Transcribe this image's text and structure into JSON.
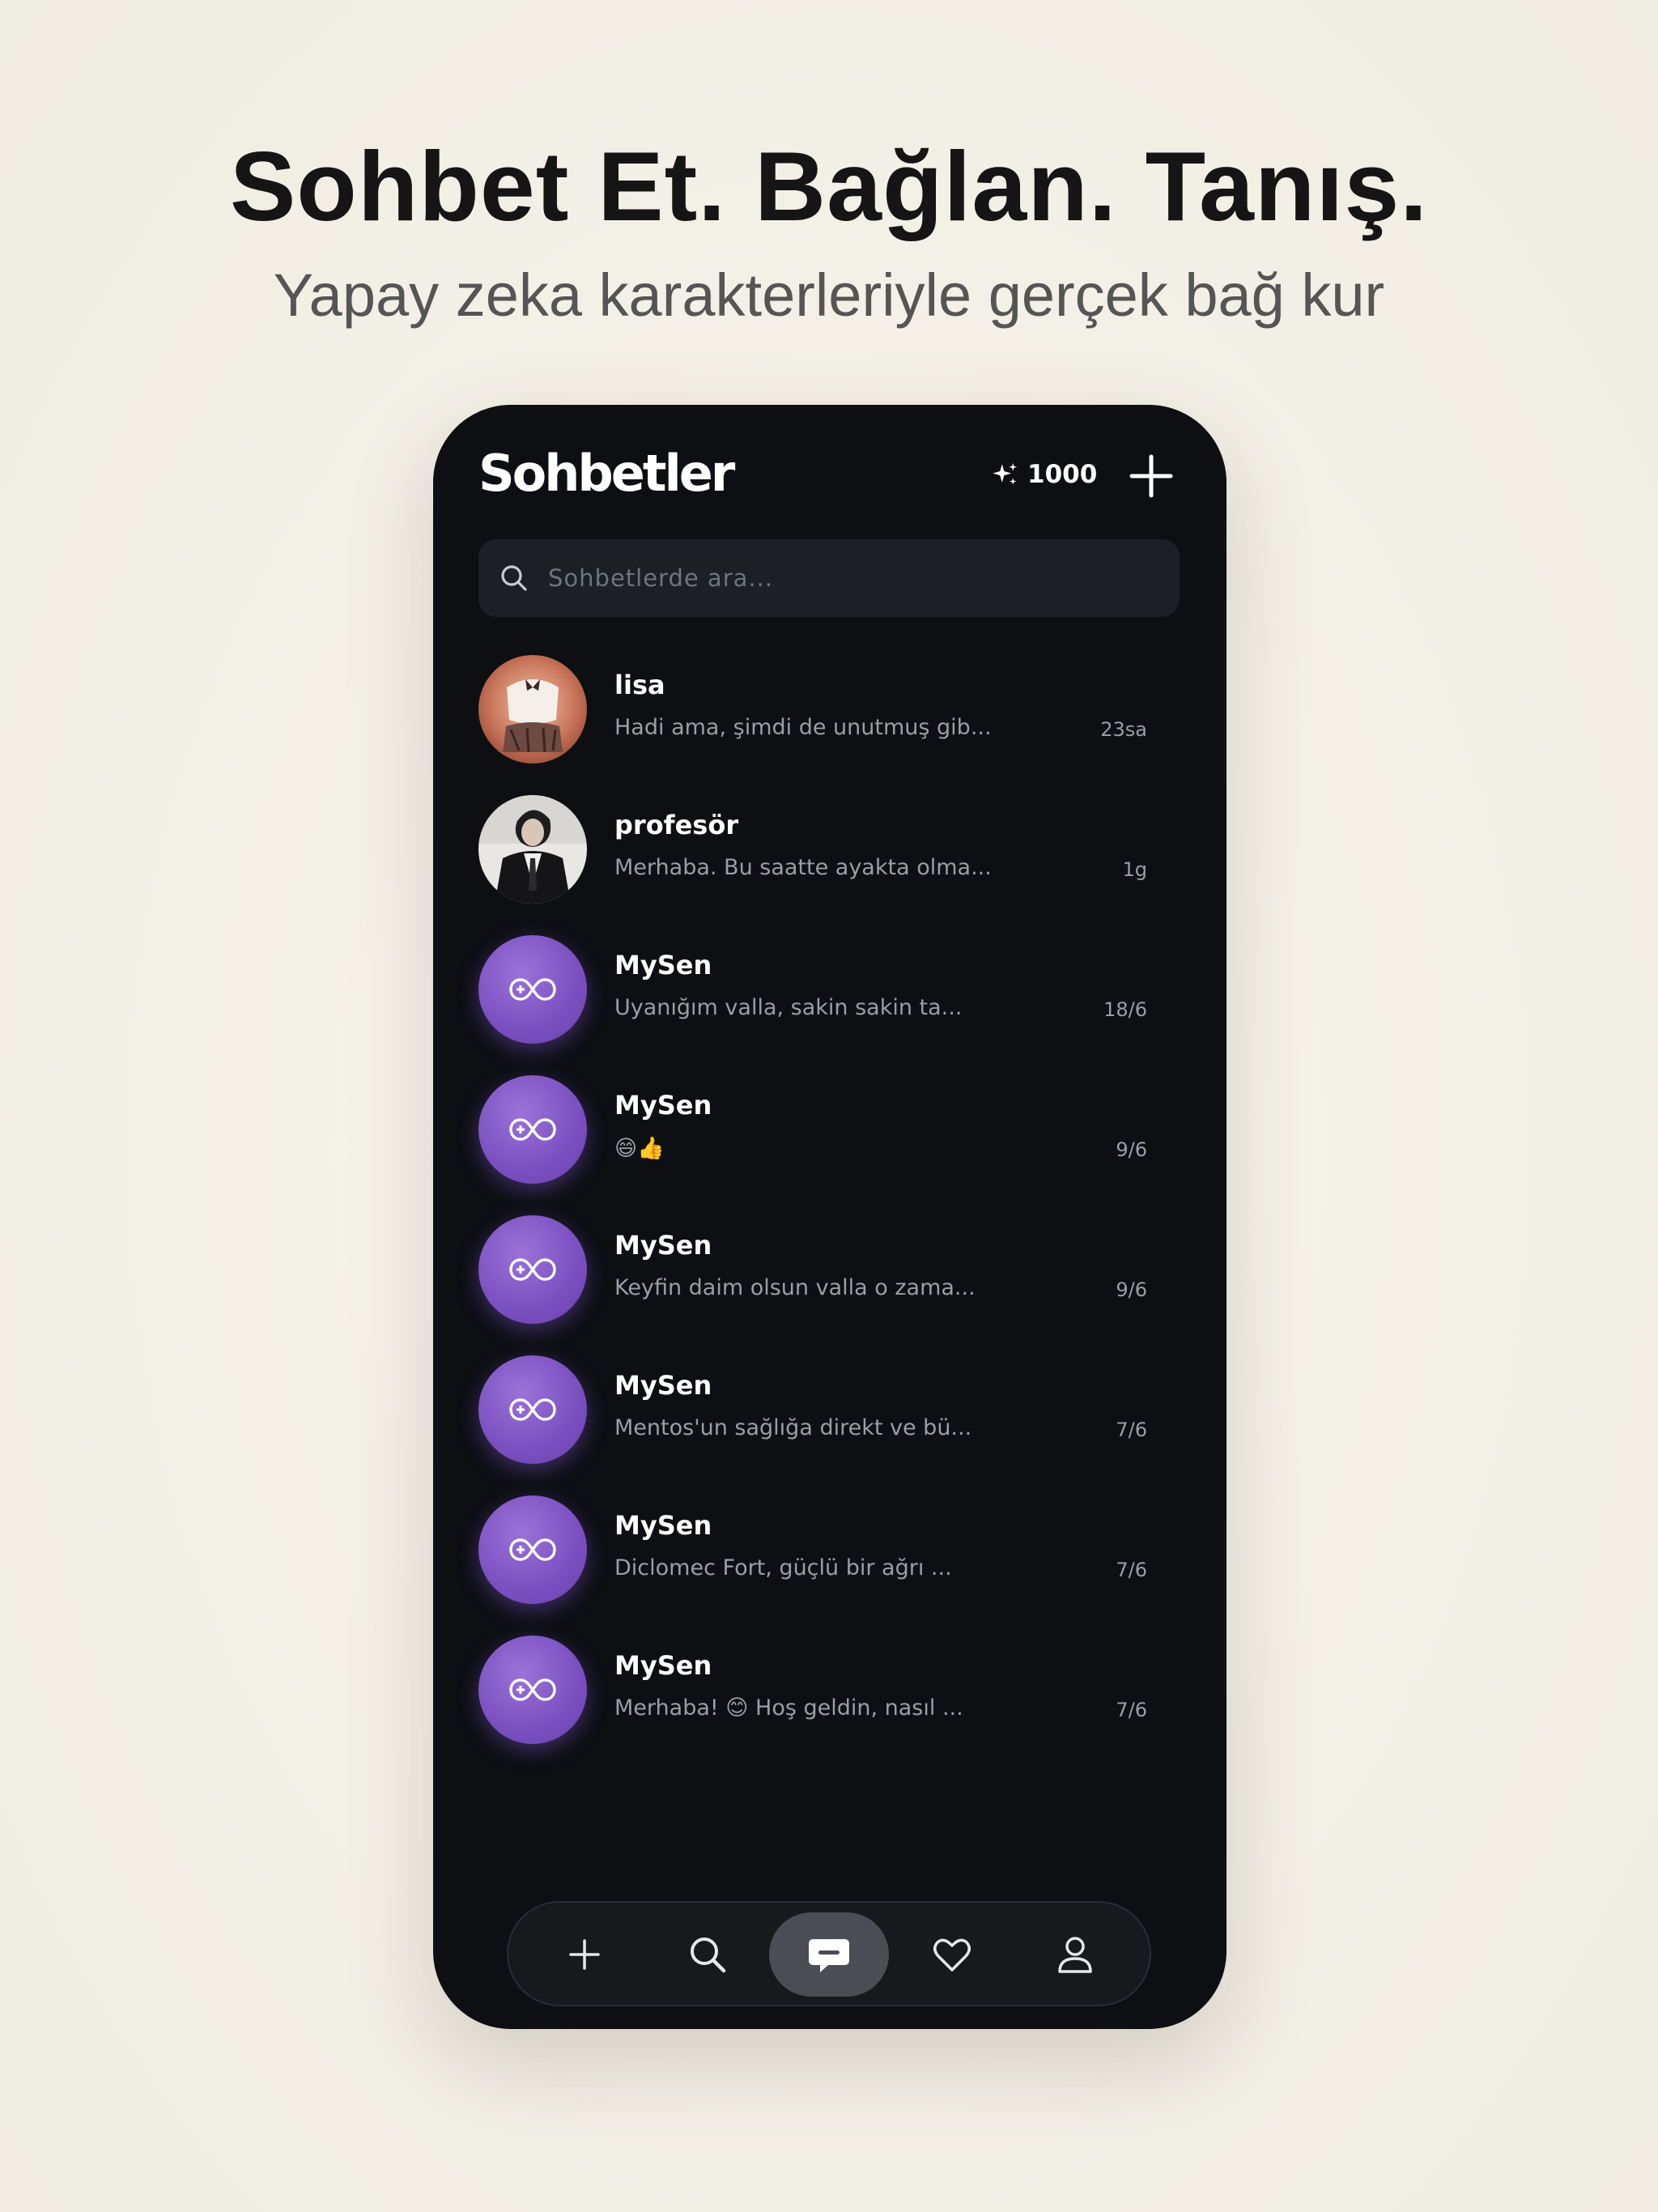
{
  "headline": "Sohbet Et. Bağlan. Tanış.",
  "subheadline": "Yapay zeka karakterleriyle gerçek bağ kur",
  "app": {
    "title": "Sohbetler",
    "credits": "1000",
    "search_placeholder": "Sohbetlerde ara..."
  },
  "chats": [
    {
      "name": "lisa",
      "preview": "Hadi ama, şimdi de unutmuş gib...",
      "time": "23sa",
      "avatar": "photo"
    },
    {
      "name": "profesör",
      "preview": "Merhaba. Bu saatte ayakta olma...",
      "time": "1g",
      "avatar": "photo"
    },
    {
      "name": "MySen",
      "preview": "Uyanığım valla, sakin sakin ta...",
      "time": "18/6",
      "avatar": "infinity-chat-icon"
    },
    {
      "name": "MySen",
      "preview": "😄👍",
      "time": "9/6",
      "avatar": "infinity-chat-icon"
    },
    {
      "name": "MySen",
      "preview": "Keyfin daim olsun valla o zama...",
      "time": "9/6",
      "avatar": "infinity-chat-icon"
    },
    {
      "name": "MySen",
      "preview": "Mentos'un sağlığa direkt ve bü...",
      "time": "7/6",
      "avatar": "infinity-chat-icon"
    },
    {
      "name": "MySen",
      "preview": "Diclomec Fort, güçlü bir ağrı ...",
      "time": "7/6",
      "avatar": "infinity-chat-icon"
    },
    {
      "name": "MySen",
      "preview": "Merhaba! 😊 Hoş geldin, nasıl ...",
      "time": "7/6",
      "avatar": "infinity-chat-icon"
    }
  ],
  "nav": [
    "plus-icon",
    "search-icon",
    "chat-icon",
    "heart-icon",
    "profile-icon"
  ],
  "colors": {
    "background": "#f1eee4",
    "phone": "#0d0f13",
    "accent_purple": "#7a4fc0",
    "nav_active": "#4a4d53"
  }
}
